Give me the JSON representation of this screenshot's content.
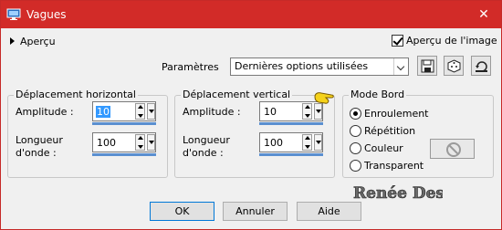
{
  "window": {
    "title": "Vagues",
    "close_symbol": "✕",
    "titlebar_color": "#d22b28"
  },
  "preview": {
    "toggle_label": "Aperçu",
    "checkbox_label": "Aperçu de l'image",
    "checked": true
  },
  "settings": {
    "label": "Paramètres",
    "selected": "Dernières options utilisées"
  },
  "horizontal": {
    "title": "Déplacement horizontal",
    "amplitude_label": "Amplitude :",
    "amplitude_value": "10",
    "wavelength_label_1": "Longueur",
    "wavelength_label_2": "d'onde :",
    "wavelength_value": "100"
  },
  "vertical": {
    "title": "Déplacement vertical",
    "amplitude_label": "Amplitude :",
    "amplitude_value": "10",
    "wavelength_label_1": "Longueur",
    "wavelength_label_2": "d'onde :",
    "wavelength_value": "100"
  },
  "edge_mode": {
    "title": "Mode Bord",
    "options": [
      "Enroulement",
      "Répétition",
      "Couleur",
      "Transparent"
    ],
    "selected": "Enroulement"
  },
  "buttons": {
    "ok": "OK",
    "cancel": "Annuler",
    "help": "Aide"
  },
  "watermark": {
    "text": "Renée Design"
  }
}
